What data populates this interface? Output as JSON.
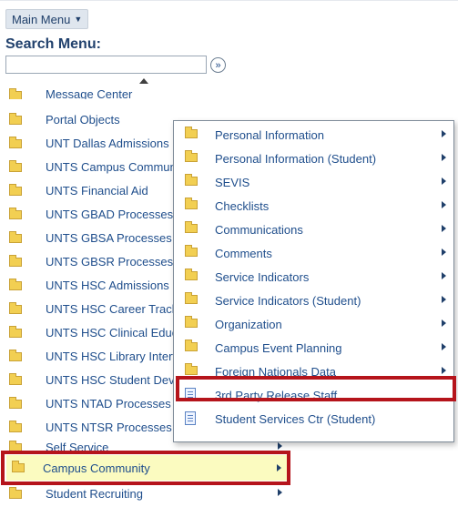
{
  "main_menu": {
    "label": "Main Menu"
  },
  "search": {
    "label": "Search Menu:",
    "value": "",
    "go_icon": "double-chevron-right-icon"
  },
  "menu": {
    "items": [
      {
        "label": "Message Center",
        "icon": "folder-icon"
      },
      {
        "label": "Portal Objects",
        "icon": "folder-icon"
      },
      {
        "label": "UNT Dallas Admissions",
        "icon": "folder-icon"
      },
      {
        "label": "UNTS Campus Commun",
        "icon": "folder-icon"
      },
      {
        "label": "UNTS Financial Aid",
        "icon": "folder-icon"
      },
      {
        "label": "UNTS GBAD Processes",
        "icon": "folder-icon"
      },
      {
        "label": "UNTS GBSA Processes",
        "icon": "folder-icon"
      },
      {
        "label": "UNTS GBSR Processes",
        "icon": "folder-icon"
      },
      {
        "label": "UNTS HSC Admissions",
        "icon": "folder-icon"
      },
      {
        "label": "UNTS HSC Career Track",
        "icon": "folder-icon"
      },
      {
        "label": "UNTS HSC Clinical Educ",
        "icon": "folder-icon"
      },
      {
        "label": "UNTS HSC Library Interf",
        "icon": "folder-icon"
      },
      {
        "label": "UNTS HSC Student Dev",
        "icon": "folder-icon"
      },
      {
        "label": "UNTS NTAD Processes",
        "icon": "folder-icon"
      },
      {
        "label": "UNTS NTSR Processes",
        "icon": "folder-icon"
      },
      {
        "label": "Self Service",
        "icon": "folder-icon"
      },
      {
        "label": "Campus Community",
        "icon": "folder-icon"
      },
      {
        "label": "Student Recruiting",
        "icon": "folder-icon"
      }
    ]
  },
  "submenu": {
    "items": [
      {
        "label": "Personal Information",
        "icon": "folder-icon"
      },
      {
        "label": "Personal Information (Student)",
        "icon": "folder-icon"
      },
      {
        "label": "SEVIS",
        "icon": "folder-icon"
      },
      {
        "label": "Checklists",
        "icon": "folder-icon"
      },
      {
        "label": "Communications",
        "icon": "folder-icon"
      },
      {
        "label": "Comments",
        "icon": "folder-icon"
      },
      {
        "label": "Service Indicators",
        "icon": "folder-icon"
      },
      {
        "label": "Service Indicators (Student)",
        "icon": "folder-icon"
      },
      {
        "label": "Organization",
        "icon": "folder-icon"
      },
      {
        "label": "Campus Event Planning",
        "icon": "folder-icon"
      },
      {
        "label": "Foreign Nationals Data",
        "icon": "folder-icon"
      },
      {
        "label": "3rd Party Release Staff",
        "icon": "page-icon"
      },
      {
        "label": "Student Services Ctr (Student)",
        "icon": "page-icon"
      }
    ]
  },
  "colors": {
    "highlight_border": "#b5141b",
    "selected_row_bg": "#fbfbc0",
    "link": "#1f4e8c"
  }
}
